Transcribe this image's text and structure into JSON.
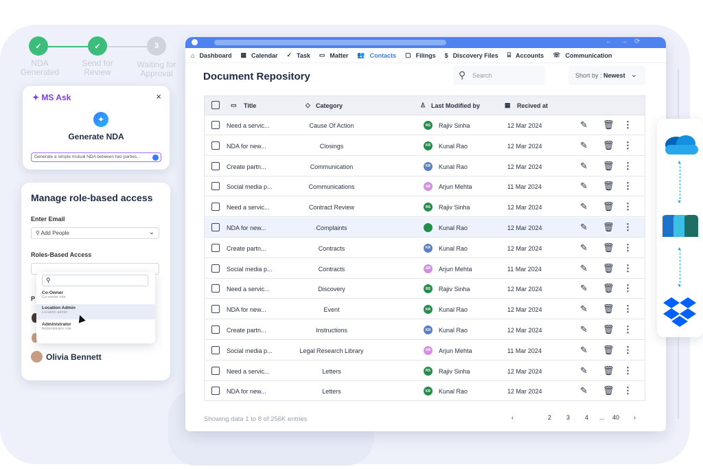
{
  "steps": [
    {
      "label": "NDA Generated",
      "state": "done",
      "mark": "✓"
    },
    {
      "label": "Send for Review",
      "state": "done",
      "mark": "✓"
    },
    {
      "label": "Waiting for Approval",
      "state": "pending",
      "mark": "3"
    }
  ],
  "ms_ask": {
    "brand": "MS Ask",
    "close": "×",
    "title": "Generate NDA",
    "prompt": "Generate a simple mutual NDA between two parties..."
  },
  "role_access": {
    "title": "Manage role-based access",
    "email_label": "Enter Email",
    "email_placeholder": "Add People",
    "roles_label": "Roles-Based Access",
    "partial_label": "P",
    "options": [
      {
        "title": "Co-Owner",
        "sub": "Co-owner role"
      },
      {
        "title": "Location Admin",
        "sub": "Location admin"
      },
      {
        "title": "Administrator",
        "sub": "Administrator role"
      }
    ],
    "person": "Olivia Bennett"
  },
  "nav": [
    {
      "label": "Dashboard",
      "icon": "home-icon",
      "glyph": "⌂"
    },
    {
      "label": "Calendar",
      "icon": "calendar-icon",
      "glyph": "▦"
    },
    {
      "label": "Task",
      "icon": "task-icon",
      "glyph": "✓"
    },
    {
      "label": "Matter",
      "icon": "briefcase-icon",
      "glyph": "▭"
    },
    {
      "label": "Contacts",
      "icon": "contacts-icon",
      "glyph": "👥",
      "active": true
    },
    {
      "label": "Filings",
      "icon": "folder-icon",
      "glyph": "▢"
    },
    {
      "label": "Discovery Files",
      "icon": "dollar-icon",
      "glyph": "$"
    },
    {
      "label": "Accounts",
      "icon": "bank-icon",
      "glyph": "⌸"
    },
    {
      "label": "Communication",
      "icon": "phone-icon",
      "glyph": "☏"
    }
  ],
  "repo": {
    "title": "Document Repository",
    "search_placeholder": "Search",
    "sort_label": "Short by :",
    "sort_value": "Newest"
  },
  "table": {
    "headers": {
      "title": "Title",
      "category": "Category",
      "modified": "Last Modified by",
      "received": "Recived at"
    },
    "rows": [
      {
        "title": "Need a servic...",
        "category": "Cause Of Action",
        "initials": "RS",
        "user": "Rajiv Sinha",
        "color": "#1f8f4a",
        "date": "12 Mar 2024"
      },
      {
        "title": "NDA for new...",
        "category": "Closings",
        "initials": "KR",
        "user": "Kunal Rao",
        "color": "#1f8f4a",
        "date": "12 Mar 2024"
      },
      {
        "title": "Create partn...",
        "category": "Communication",
        "initials": "KR",
        "user": "Kunal Rao",
        "color": "#5b7fc7",
        "date": "12 Mar 2024"
      },
      {
        "title": "Social media p...",
        "category": "Communications",
        "initials": "AR",
        "user": "Arjun Mehta",
        "color": "#d38ee8",
        "date": "11 Mar 2024"
      },
      {
        "title": "Need a servic...",
        "category": "Contract Review",
        "initials": "RS",
        "user": "Rajiv Sinha",
        "color": "#1f8f4a",
        "date": "12 Mar 2024"
      },
      {
        "title": "NDA for new...",
        "category": "Complaints",
        "initials": "",
        "user": "Kunal Rao",
        "color": "#1f8f4a",
        "date": "12 Mar 2024",
        "selected": true
      },
      {
        "title": "Create partn...",
        "category": "Contracts",
        "initials": "KR",
        "user": "Kunal Rao",
        "color": "#5b7fc7",
        "date": "12 Mar 2024"
      },
      {
        "title": "Social media p...",
        "category": "Contracts",
        "initials": "AR",
        "user": "Arjun Mehta",
        "color": "#d38ee8",
        "date": "11 Mar 2024"
      },
      {
        "title": "Need a servic...",
        "category": "Discovery",
        "initials": "RS",
        "user": "Rajiv Sinha",
        "color": "#1f8f4a",
        "date": "12 Mar 2024"
      },
      {
        "title": "NDA for new...",
        "category": "Event",
        "initials": "KR",
        "user": "Kunal Rao",
        "color": "#1f8f4a",
        "date": "12 Mar 2024"
      },
      {
        "title": "Create partn...",
        "category": "Instructions",
        "initials": "KR",
        "user": "Kunal Rao",
        "color": "#5b7fc7",
        "date": "12 Mar 2024"
      },
      {
        "title": "Social media p...",
        "category": "Legal Research Library",
        "initials": "AR",
        "user": "Arjun Mehta",
        "color": "#d38ee8",
        "date": "11 Mar 2024"
      },
      {
        "title": "Need a servic...",
        "category": "Letters",
        "initials": "RS",
        "user": "Rajiv Sinha",
        "color": "#1f8f4a",
        "date": "12 Mar 2024"
      },
      {
        "title": "NDA for new...",
        "category": "Letters",
        "initials": "KR",
        "user": "Kunal Rao",
        "color": "#1f8f4a",
        "date": "12 Mar 2024"
      }
    ]
  },
  "footer": {
    "summary": "Showing data 1 to 8 of  256K entries",
    "pages": [
      "‹",
      "2",
      "3",
      "4",
      "...",
      "40",
      "›"
    ]
  },
  "integrations": [
    "onedrive-icon",
    "app-logo-icon",
    "dropbox-icon"
  ]
}
